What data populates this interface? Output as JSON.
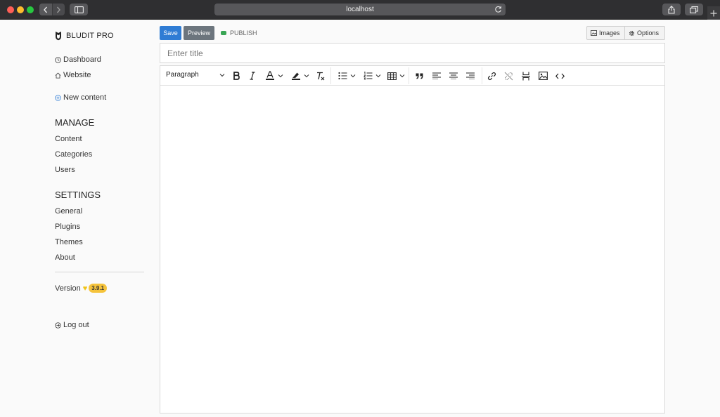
{
  "browser": {
    "url": "localhost"
  },
  "sidebar": {
    "brand": "BLUDIT PRO",
    "quick_links": [
      {
        "label": "Dashboard",
        "icon": "dashboard-icon"
      },
      {
        "label": "Website",
        "icon": "home-icon"
      },
      {
        "label": "New content",
        "icon": "plus-circle-icon"
      }
    ],
    "manage": {
      "heading": "MANAGE",
      "items": [
        "Content",
        "Categories",
        "Users"
      ]
    },
    "settings": {
      "heading": "SETTINGS",
      "items": [
        "General",
        "Plugins",
        "Themes",
        "About"
      ]
    },
    "version_label": "Version",
    "version_number": "3.9.1",
    "logout_label": "Log out"
  },
  "editor": {
    "save_label": "Save",
    "preview_label": "Preview",
    "status_label": "PUBLISH",
    "images_label": "Images",
    "options_label": "Options",
    "title_placeholder": "Enter title",
    "title_value": "",
    "block_format": "Paragraph",
    "content": ""
  },
  "colors": {
    "primary": "#2f7cd4",
    "secondary": "#6c757d",
    "publish": "#3aa655",
    "version_badge": "#f5c33b"
  }
}
